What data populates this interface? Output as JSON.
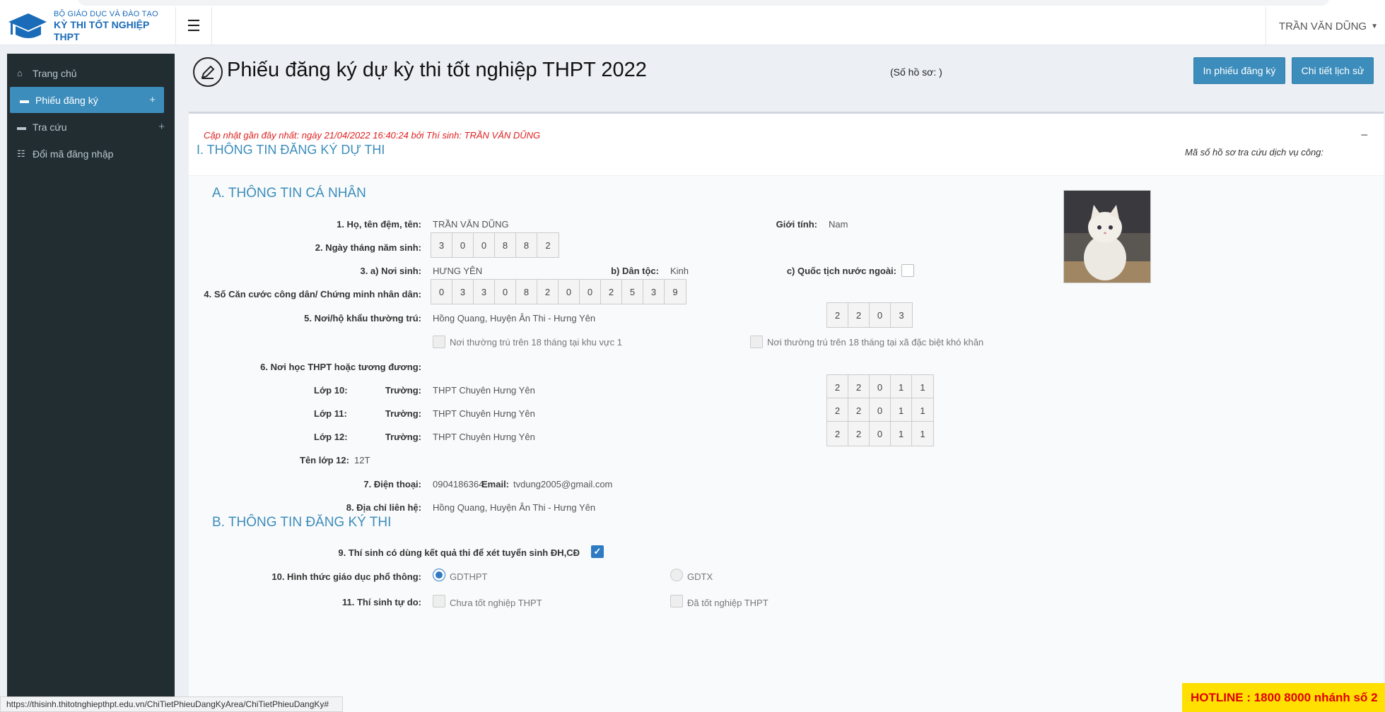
{
  "header": {
    "logo_line1": "BỘ GIÁO DỤC VÀ ĐÀO TẠO",
    "logo_line2": "KỲ THI TỐT NGHIỆP THPT",
    "user_name": "TRẦN VĂN DŨNG"
  },
  "sidebar": {
    "items": [
      {
        "label": "Trang chủ",
        "icon": "home-icon"
      },
      {
        "label": "Phiếu đăng ký",
        "icon": "folder-icon",
        "active": true
      },
      {
        "label": "Tra cứu",
        "icon": "folder-icon"
      },
      {
        "label": "Đổi mã đăng nhập",
        "icon": "list-icon"
      }
    ]
  },
  "page": {
    "title": "Phiếu đăng ký dự kỳ thi tốt nghiệp THPT 2022",
    "so_ho_so": "(Số hồ sơ: )",
    "btn_print": "In phiếu đăng ký",
    "btn_history": "Chi tiết lịch sử"
  },
  "box": {
    "updated": "Cập nhật gần đây nhất: ngày 21/04/2022 16:40:24 bởi Thí sinh: TRẦN VĂN DŨNG",
    "section1": "I. THÔNG TIN ĐĂNG KÝ DỰ THI",
    "collapse": "−",
    "ma_so": "Mã số hồ sơ tra cứu dịch vụ công:"
  },
  "a": {
    "title": "A. THÔNG TIN CÁ NHÂN",
    "name_label": "1. Họ, tên đệm, tên:",
    "name": "TRẦN VĂN DŨNG",
    "gender_label": "Giới tính:",
    "gender": "Nam",
    "dob_label": "2. Ngày tháng năm sinh:",
    "dob_digits": [
      "3",
      "0",
      "0",
      "8",
      "8",
      "2"
    ],
    "pob_label": "3. a) Nơi sinh:",
    "pob": "HƯNG YÊN",
    "ethnic_label": "b) Dân tộc:",
    "ethnic": "Kinh",
    "foreign_label": "c) Quốc tịch nước ngoài:",
    "id_label": "4. Số Căn cước công dân/ Chứng minh nhân dân:",
    "id_digits": [
      "0",
      "3",
      "3",
      "0",
      "8",
      "2",
      "0",
      "0",
      "2",
      "5",
      "3",
      "9"
    ],
    "residence_label": "5. Nơi/hộ khẩu thường trú:",
    "residence": "Hồng Quang, Huyện Ân Thi - Hưng Yên",
    "residence_code": [
      "2",
      "2",
      "0",
      "3"
    ],
    "kv1_label": "Nơi thường trú trên 18 tháng tại khu vực 1",
    "dbkk_label": "Nơi thường trú trên 18 tháng tại xã đặc biệt khó khăn",
    "school_label": "6. Nơi học THPT hoặc tương đương:",
    "truong_label": "Trường:",
    "grades": [
      {
        "label": "Lớp 10:",
        "school": "THPT Chuyên Hưng Yên",
        "code": [
          "2",
          "2",
          "0",
          "1",
          "1"
        ]
      },
      {
        "label": "Lớp 11:",
        "school": "THPT Chuyên Hưng Yên",
        "code": [
          "2",
          "2",
          "0",
          "1",
          "1"
        ]
      },
      {
        "label": "Lớp 12:",
        "school": "THPT Chuyên Hưng Yên",
        "code": [
          "2",
          "2",
          "0",
          "1",
          "1"
        ]
      }
    ],
    "class_label": "Tên lớp 12:",
    "class_name": "12T",
    "phone_label": "7. Điện thoại:",
    "phone": "0904186364",
    "email_label": "Email:",
    "email": "tvdung2005@gmail.com",
    "address_label": "8. Địa chỉ liên hệ:",
    "address": "Hồng Quang, Huyện Ân Thi - Hưng Yên"
  },
  "b": {
    "title": "B. THÔNG TIN ĐĂNG KÝ THI",
    "q9_label": "9. Thí sinh có dùng kết quả thi để xét tuyển sinh ĐH,CĐ",
    "q10_label": "10. Hình thức giáo dục phổ thông:",
    "q10_opt1": "GDTHPT",
    "q10_opt2": "GDTX",
    "q11_label": "11. Thí sinh tự do:",
    "q11_opt1": "Chưa tốt nghiệp THPT",
    "q11_opt2": "Đã tốt nghiệp THPT"
  },
  "statusbar": "https://thisinh.thitotnghiepthpt.edu.vn/ChiTietPhieuDangKyArea/ChiTietPhieuDangKy#",
  "hotline": "HOTLINE : 1800 8000 nhánh số 2",
  "colors": {
    "primary": "#3c8dbc",
    "sidebar": "#222d32",
    "hotline_bg": "#ffe000",
    "hotline_text": "#e00000",
    "updated_text": "#e02020"
  }
}
